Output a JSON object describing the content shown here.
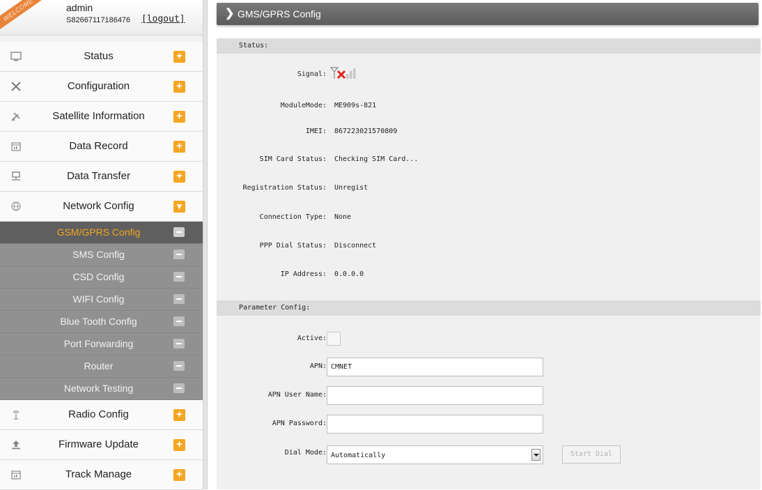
{
  "user": {
    "welcome_ribbon": "WELCOME",
    "name": "admin",
    "serial": "S82667117186476",
    "logout_label": "logout"
  },
  "menu": {
    "items_top": [
      {
        "label": "Status",
        "icon": "monitor-icon",
        "toggle": "+"
      },
      {
        "label": "Configuration",
        "icon": "tools-icon",
        "toggle": "+"
      },
      {
        "label": "Satellite Information",
        "icon": "satellite-icon",
        "toggle": "+"
      },
      {
        "label": "Data Record",
        "icon": "calendar-icon",
        "toggle": "+"
      },
      {
        "label": "Data Transfer",
        "icon": "network-transfer-icon",
        "toggle": "+"
      },
      {
        "label": "Network Config",
        "icon": "globe-icon",
        "toggle": "▾"
      }
    ],
    "submenu": [
      {
        "label": "GSM/GPRS Config",
        "active": true
      },
      {
        "label": "SMS Config"
      },
      {
        "label": "CSD Config"
      },
      {
        "label": "WIFI Config"
      },
      {
        "label": "Blue Tooth Config"
      },
      {
        "label": "Port Forwarding"
      },
      {
        "label": "Router"
      },
      {
        "label": "Network Testing"
      }
    ],
    "items_bottom": [
      {
        "label": "Radio Config",
        "icon": "radio-antenna-icon",
        "toggle": "+"
      },
      {
        "label": "Firmware Update",
        "icon": "upload-icon",
        "toggle": "+"
      },
      {
        "label": "Track Manage",
        "icon": "calendar-icon",
        "toggle": "+"
      }
    ]
  },
  "page": {
    "title": "GMS/GPRS Config"
  },
  "status": {
    "heading": "Status:",
    "signal_label": "Signal:",
    "signal_icon": "signal-no-service-icon",
    "module_mode_label": "ModuleMode:",
    "module_mode": "ME909s-821",
    "imei_label": "IMEI:",
    "imei": "867223021570809",
    "sim_label": "SIM Card Status:",
    "sim_status": "Checking SIM Card...",
    "reg_label": "Registration Status:",
    "reg_status": "Unregist",
    "conn_label": "Connection Type:",
    "conn_type": "None",
    "ppp_label": "PPP Dial Status:",
    "ppp_status": "Disconnect",
    "ip_label": "IP Address:",
    "ip": "0.0.0.0"
  },
  "params": {
    "heading": "Parameter Config:",
    "active_label": "Active:",
    "active_checked": false,
    "apn_label": "APN:",
    "apn_value": "CMNET",
    "apn_user_label": "APN User Name:",
    "apn_user_value": "",
    "apn_pass_label": "APN Password:",
    "apn_pass_value": "",
    "dial_mode_label": "Dial Mode:",
    "dial_mode_value": "Automatically",
    "start_dial_label": "Start Dial"
  },
  "colors": {
    "accent": "#f5a623",
    "titlebar": "#6b6b6b",
    "submenu_bg": "#919191",
    "submenu_active_bg": "#5f5f5f",
    "signal_x": "#e0241b"
  }
}
